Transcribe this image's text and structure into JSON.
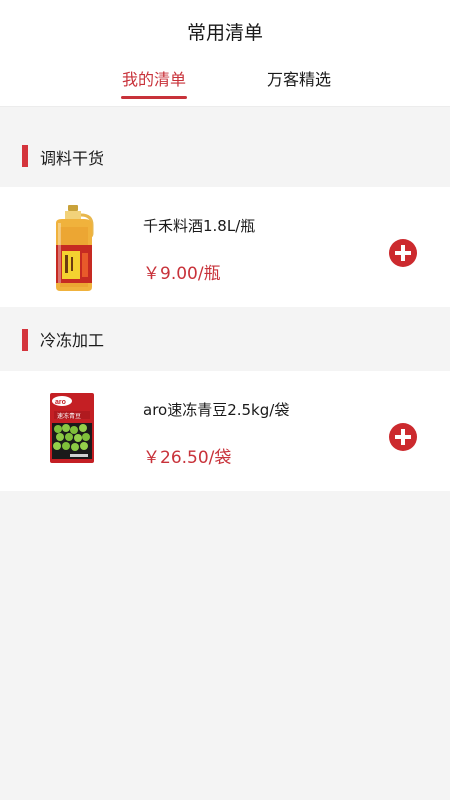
{
  "header": {
    "title": "常用清单",
    "tabs": [
      {
        "label": "我的清单",
        "active": true
      },
      {
        "label": "万客精选",
        "active": false
      }
    ]
  },
  "sections": [
    {
      "title": "调料干货",
      "items": [
        {
          "name": "千禾料酒1.8L/瓶",
          "price": "￥9.00/瓶",
          "icon": "cooking-wine-bottle"
        }
      ]
    },
    {
      "title": "冷冻加工",
      "items": [
        {
          "name": "aro速冻青豆2.5kg/袋",
          "price": "￥26.50/袋",
          "icon": "frozen-peas-bag",
          "package_brand": "aro",
          "package_text": "速冻青豆"
        }
      ]
    }
  ],
  "colors": {
    "accent": "#c8323a",
    "section_bar": "#d4343c",
    "add_button": "#cc2a2e",
    "background": "#f4f4f4"
  }
}
